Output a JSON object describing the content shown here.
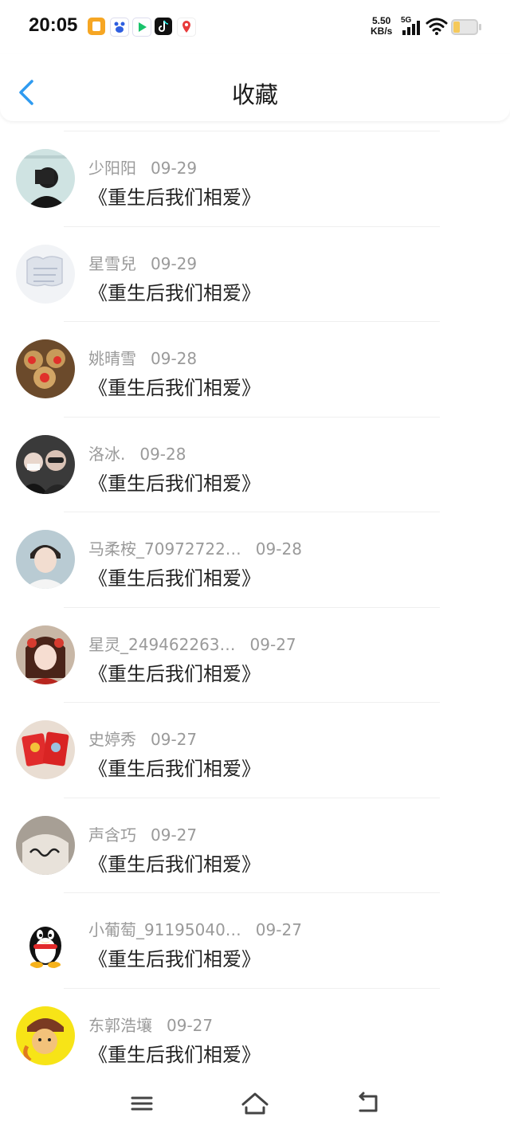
{
  "status_bar": {
    "time": "20:05",
    "net_speed_value": "5.50",
    "net_speed_unit": "KB/s",
    "network_type": "5G",
    "app_icons": [
      "notes-icon",
      "baidu-icon",
      "video-icon",
      "tiktok-icon",
      "map-icon"
    ],
    "battery_color": "#f5c95a"
  },
  "header": {
    "title": "收藏"
  },
  "accent_color": "#2f9bf0",
  "favorites": [
    {
      "user": "少阳阳",
      "date": "09-29",
      "book": "《重生后我们相爱》"
    },
    {
      "user": "星雪兒",
      "date": "09-29",
      "book": "《重生后我们相爱》"
    },
    {
      "user": "姚晴雪",
      "date": "09-28",
      "book": "《重生后我们相爱》"
    },
    {
      "user": "洛冰.",
      "date": "09-28",
      "book": "《重生后我们相爱》"
    },
    {
      "user": "马柔桉_70972722…",
      "date": "09-28",
      "book": "《重生后我们相爱》"
    },
    {
      "user": "星灵_249462263…",
      "date": "09-27",
      "book": "《重生后我们相爱》"
    },
    {
      "user": "史婷秀",
      "date": "09-27",
      "book": "《重生后我们相爱》"
    },
    {
      "user": "声含巧",
      "date": "09-27",
      "book": "《重生后我们相爱》"
    },
    {
      "user": "小葡萄_91195040…",
      "date": "09-27",
      "book": "《重生后我们相爱》"
    },
    {
      "user": "东郭浩壤",
      "date": "09-27",
      "book": "《重生后我们相爱》"
    }
  ],
  "nav_bar": {
    "icons": [
      "menu-icon",
      "home-icon",
      "back-icon"
    ]
  }
}
